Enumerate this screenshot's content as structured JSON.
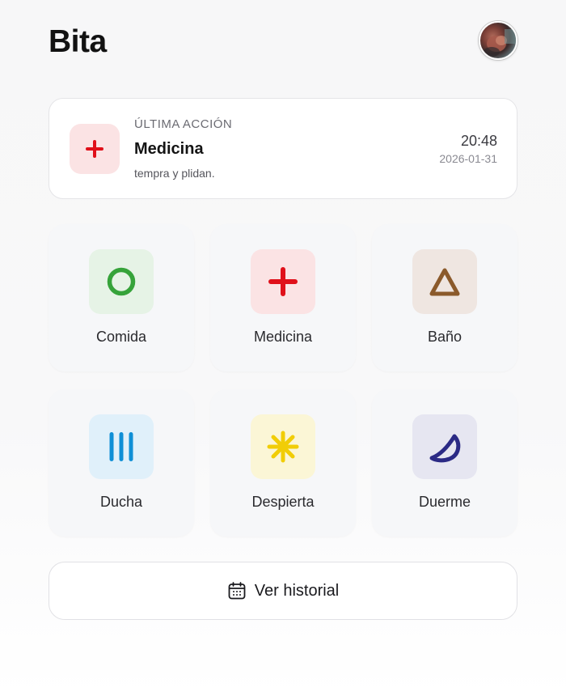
{
  "app": {
    "title": "Bita"
  },
  "last_action": {
    "eyebrow": "ÚLTIMA ACCIÓN",
    "name": "Medicina",
    "note": "tempra y plidan.",
    "time": "20:48",
    "date": "2026-01-31",
    "icon": "plus-icon",
    "icon_color": "#e0101a",
    "icon_bg": "#fbe3e4"
  },
  "actions": [
    {
      "label": "Comida",
      "icon": "circle-icon",
      "color": "#36a33a",
      "bg": "#e6f3e6"
    },
    {
      "label": "Medicina",
      "icon": "plus-icon",
      "color": "#e0101a",
      "bg": "#fbe3e4"
    },
    {
      "label": "Baño",
      "icon": "triangle-icon",
      "color": "#8b5a2b",
      "bg": "#efe6e1"
    },
    {
      "label": "Ducha",
      "icon": "bars-icon",
      "color": "#0f8fd6",
      "bg": "#e0f0fa"
    },
    {
      "label": "Despierta",
      "icon": "asterisk-icon",
      "color": "#f1cd07",
      "bg": "#fbf6d6"
    },
    {
      "label": "Duerme",
      "icon": "moon-icon",
      "color": "#2b2a85",
      "bg": "#e6e6f1"
    }
  ],
  "history_button": {
    "label": "Ver historial",
    "icon": "calendar-icon"
  }
}
